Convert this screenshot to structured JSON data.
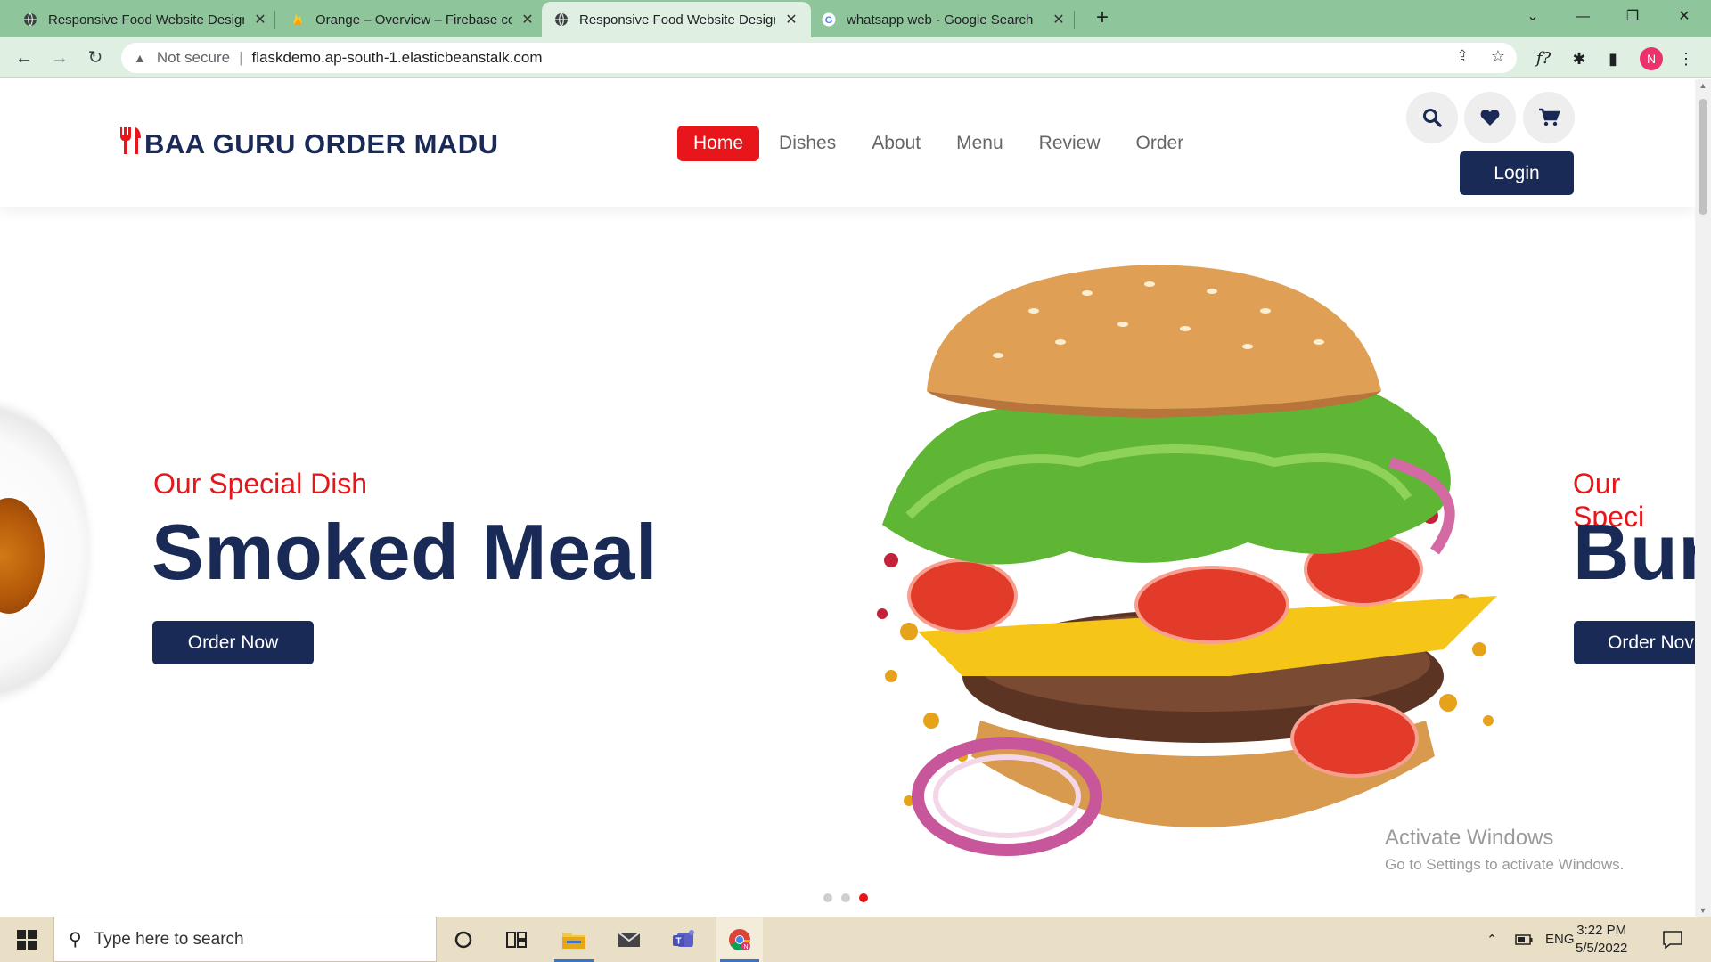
{
  "browser": {
    "tabs": [
      {
        "title": "Responsive Food Website Design",
        "active": false,
        "favicon": "globe-icon"
      },
      {
        "title": "Orange – Overview – Firebase co",
        "active": false,
        "favicon": "firebase-icon"
      },
      {
        "title": "Responsive Food Website Design",
        "active": true,
        "favicon": "globe-icon"
      },
      {
        "title": "whatsapp web - Google Search",
        "active": false,
        "favicon": "google-icon"
      }
    ],
    "security_label": "Not secure",
    "url": "flaskdemo.ap-south-1.elasticbeanstalk.com",
    "profile_initial": "N",
    "accent_color": "#8fc59a"
  },
  "site": {
    "logo_text": "BAA GURU ORDER MADU",
    "nav": [
      "Home",
      "Dishes",
      "About",
      "Menu",
      "Review",
      "Order"
    ],
    "active_nav": "Home",
    "login_label": "Login",
    "brand_red": "#e8151b",
    "brand_navy": "#192a56"
  },
  "slider": {
    "current": {
      "subtitle": "Our Special Dish",
      "title": "Smoked Meal",
      "button": "Order Now"
    },
    "next": {
      "subtitle": "Our Speci",
      "title": "Bur",
      "button": "Order Nov"
    },
    "dots_count": 3,
    "active_dot": 3
  },
  "watermark": {
    "line1": "Activate Windows",
    "line2": "Go to Settings to activate Windows."
  },
  "taskbar": {
    "search_placeholder": "Type here to search",
    "language": "ENG",
    "time": "3:22 PM",
    "date": "5/5/2022"
  }
}
